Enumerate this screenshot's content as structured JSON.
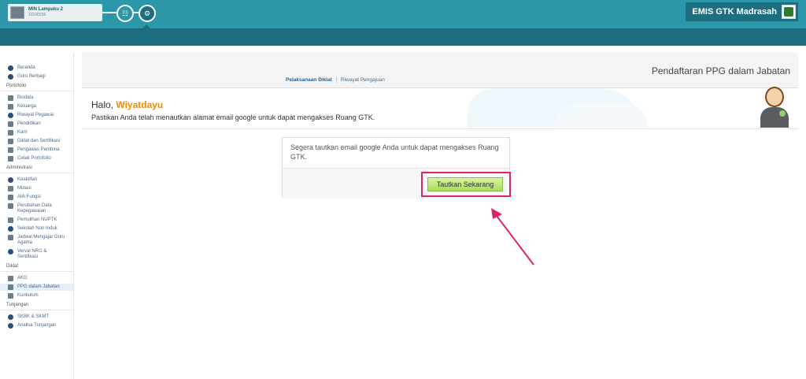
{
  "topbar": {
    "school_name": "MIN Lampaku 2",
    "school_id": "10100236",
    "brand": "EMIS GTK Madrasah"
  },
  "sidebar": {
    "main_items": [
      {
        "label": "Beranda",
        "icon": "info-icon"
      },
      {
        "label": "Guru Berbagi",
        "icon": "info-icon"
      }
    ],
    "sections": [
      {
        "title": "Portofolio",
        "items": [
          "Biodata",
          "Keluarga",
          "Riwayat Pegawai",
          "Pendidikan",
          "Karir",
          "Diklat dan Sertifikasi",
          "Pengawas Pembina",
          "Cetak Portofolio"
        ]
      },
      {
        "title": "Administrasi",
        "items": [
          "Keaktifan",
          "Mutasi",
          "Alih Fungsi",
          "Perubahan Data Kepegawaian",
          "Pemulihan NUPTK",
          "Sekolah Non Induk",
          "Jadwal Mengajar Guru Agama",
          "Verval NRG & Sertifikasi"
        ]
      },
      {
        "title": "Diklat",
        "items": [
          "AKG",
          "PPG dalam Jabatan",
          "Kurikulum"
        ]
      },
      {
        "title": "Tunjangan",
        "items": [
          "SKBK & SKMT",
          "Analisa Tunjangan"
        ]
      }
    ],
    "active_item": "PPG dalam Jabatan"
  },
  "main": {
    "page_title": "Pendaftaran PPG dalam Jabatan",
    "tabs": [
      "Pelaksanaan Diklat",
      "Riwayat Pengajuan"
    ],
    "greeting_prefix": "Halo,",
    "user_name": "Wiyatdayu",
    "instruction": "Pastikan Anda telah menautkan alamat email google untuk dapat mengakses Ruang GTK.",
    "card_message": "Segera tautkan email google Anda untuk dapat mengakses Ruang GTK.",
    "button_label": "Tautkan Sekarang"
  },
  "colors": {
    "topbar": "#2c97a8",
    "subbar": "#1c6f80",
    "highlight": "#e0226d",
    "user_name": "#f08a00"
  }
}
